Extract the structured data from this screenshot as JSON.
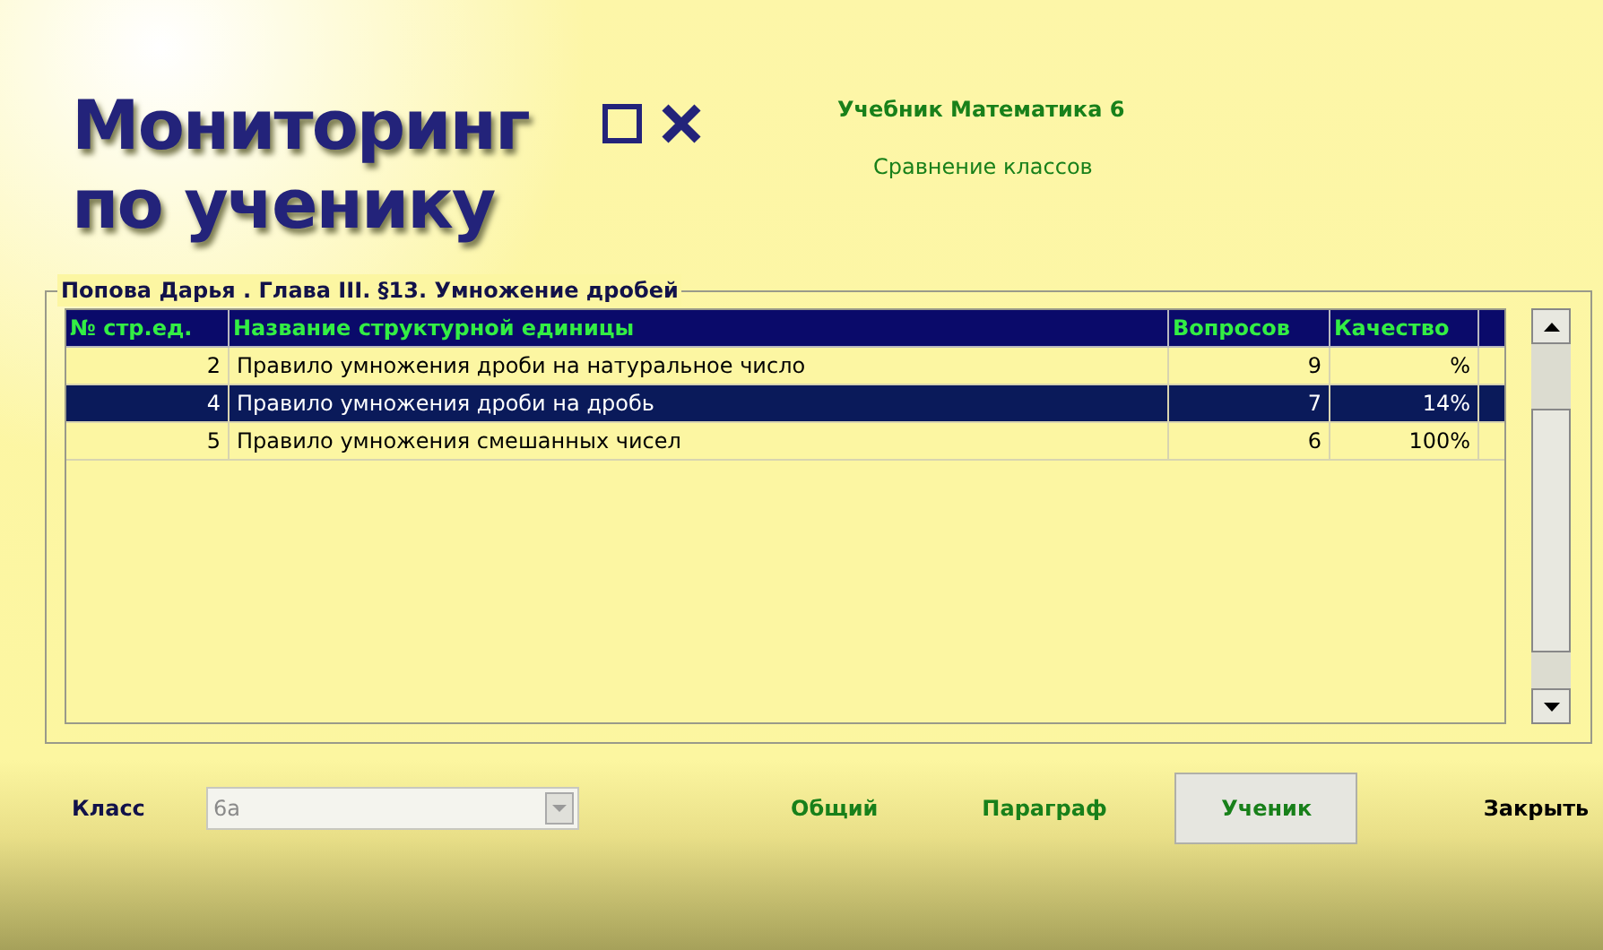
{
  "title_lines": [
    "Мониторинг",
    "по ученику"
  ],
  "textbook": "Учебник Математика 6",
  "compare_link": "Сравнение классов",
  "group_title": "Попова Дарья . Глава III. §13. Умножение дробей",
  "table": {
    "columns": [
      "№ стр.ед.",
      "Название структурной единицы",
      "Вопросов",
      "Качество"
    ],
    "rows": [
      {
        "cells": [
          "2",
          "Правило умножения дроби на натуральное число",
          "9",
          "%"
        ],
        "selected": false
      },
      {
        "cells": [
          "4",
          "Правило умножения дроби на дробь",
          "7",
          "14%"
        ],
        "selected": true
      },
      {
        "cells": [
          "5",
          "Правило умножения смешанных чисел",
          "6",
          "100%"
        ],
        "selected": false
      }
    ]
  },
  "class_label": "Класс",
  "class_select": {
    "value": "6а",
    "disabled": true
  },
  "nav_buttons": [
    {
      "label": "Общий",
      "selected": false
    },
    {
      "label": "Параграф",
      "selected": false
    },
    {
      "label": "Ученик",
      "selected": true
    }
  ],
  "close_button": "Закрыть"
}
